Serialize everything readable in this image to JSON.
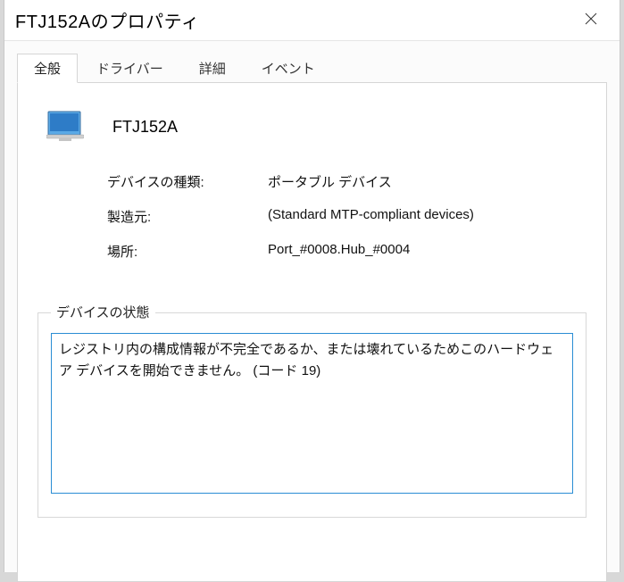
{
  "window": {
    "title": "FTJ152Aのプロパティ"
  },
  "tabs": [
    {
      "label": "全般",
      "active": true
    },
    {
      "label": "ドライバー",
      "active": false
    },
    {
      "label": "詳細",
      "active": false
    },
    {
      "label": "イベント",
      "active": false
    }
  ],
  "general": {
    "device_name": "FTJ152A",
    "rows": {
      "type_label": "デバイスの種類:",
      "type_value": "ポータブル デバイス",
      "mfr_label": "製造元:",
      "mfr_value": "(Standard MTP-compliant devices)",
      "loc_label": "場所:",
      "loc_value": "Port_#0008.Hub_#0004"
    },
    "status": {
      "legend": "デバイスの状態",
      "text": "レジストリ内の構成情報が不完全であるか、または壊れているためこのハードウェア デバイスを開始できません。 (コード 19)"
    }
  }
}
